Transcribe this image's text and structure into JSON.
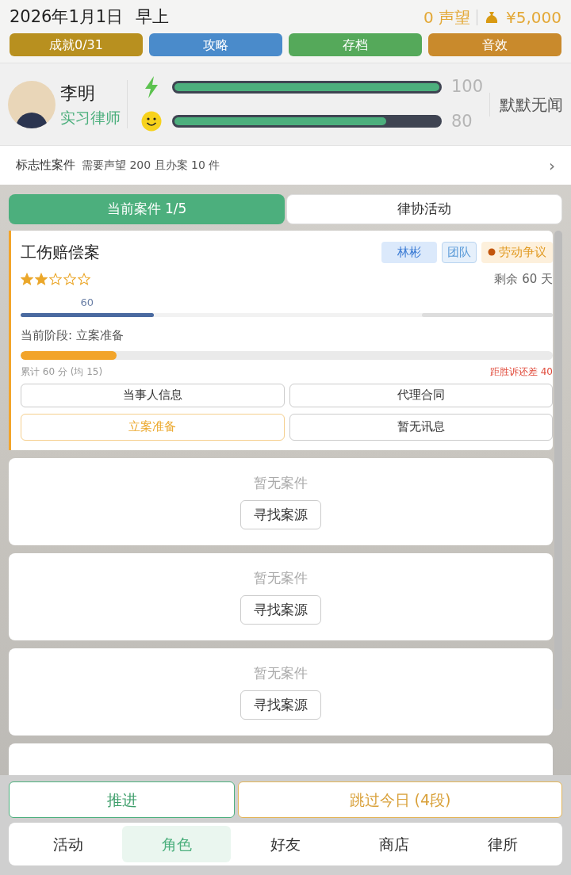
{
  "header": {
    "date": "2026年1月1日",
    "period": "早上",
    "reputation": "0 声望",
    "money": "¥5,000"
  },
  "top_buttons": [
    {
      "label": "成就0/31",
      "color": "#b8901f"
    },
    {
      "label": "攻略",
      "color": "#4a8bcb"
    },
    {
      "label": "存档",
      "color": "#55a95a"
    },
    {
      "label": "音效",
      "color": "#c98a2c"
    }
  ],
  "profile": {
    "name": "李明",
    "title": "实习律师",
    "status": "默默无闻",
    "stats": [
      {
        "kind": "energy",
        "level": 1.0,
        "reading": "100"
      },
      {
        "kind": "mood",
        "level": 0.8,
        "reading": "80"
      }
    ]
  },
  "milestone": {
    "label": "标志性案件",
    "requirement": "需要声望 200 且办案 10 件",
    "chevron": "›"
  },
  "tabs": [
    {
      "label": "当前案件 1/5",
      "selected": true
    },
    {
      "label": "律协活动",
      "selected": false
    }
  ],
  "case": {
    "title": "工伤赔偿案",
    "tags": [
      {
        "kind": "person",
        "label": "林彬"
      },
      {
        "kind": "team",
        "label": "团队"
      },
      {
        "kind": "category",
        "label": "劳动争议"
      }
    ],
    "stars": 2,
    "remaining": "剩余 60 天",
    "score": {
      "label": "60",
      "level": 0.25
    },
    "stage": "当前阶段: 立案准备",
    "stage_progress": {
      "level": 0.18
    },
    "total": "累计 60 分 (均 15)",
    "gap": "距胜诉还差 40",
    "actions": [
      {
        "label": "当事人信息",
        "selected": false
      },
      {
        "label": "代理合同",
        "selected": false
      },
      {
        "label": "立案准备",
        "selected": true
      },
      {
        "label": "暂无讯息",
        "selected": false
      }
    ]
  },
  "empty_slots": [
    {
      "text": "暂无案件",
      "button": "寻找案源"
    },
    {
      "text": "暂无案件",
      "button": "寻找案源"
    },
    {
      "text": "暂无案件",
      "button": "寻找案源"
    }
  ],
  "bottom_actions": [
    {
      "kind": "advance",
      "label": "推进"
    },
    {
      "kind": "skip",
      "label": "跳过今日 (4段)"
    }
  ],
  "nav": [
    {
      "label": "活动",
      "selected": false
    },
    {
      "label": "角色",
      "selected": true
    },
    {
      "label": "好友",
      "selected": false
    },
    {
      "label": "商店",
      "selected": false
    },
    {
      "label": "律所",
      "selected": false
    }
  ]
}
